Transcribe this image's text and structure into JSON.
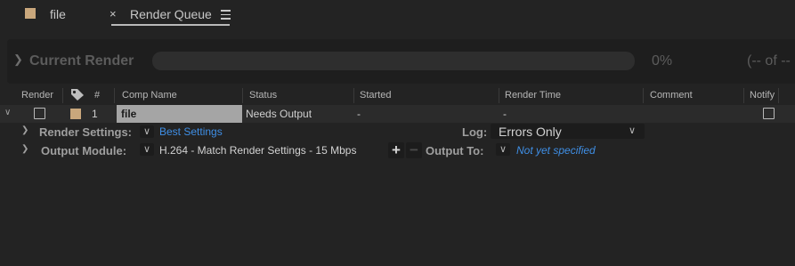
{
  "tabs": [
    {
      "label": "file"
    },
    {
      "label": "Render Queue",
      "close_glyph": "×"
    }
  ],
  "current_render": {
    "title": "Current Render",
    "percent": "0%",
    "remaining": "(-- of --"
  },
  "columns": [
    "Render",
    "#",
    "Comp Name",
    "Status",
    "Started",
    "Render Time",
    "Comment",
    "Notify"
  ],
  "row": {
    "index": "1",
    "comp_name": "file",
    "status": "Needs Output",
    "started": "-",
    "render_time": "-",
    "label_color": "#c9a77c"
  },
  "render_settings": {
    "label": "Render Settings:",
    "value": "Best Settings",
    "log_label": "Log:",
    "log_value": "Errors Only"
  },
  "output_module": {
    "label": "Output Module:",
    "value": "H.264 - Match Render Settings - 15 Mbps",
    "output_to_label": "Output To:",
    "output_to_value": "Not yet specified"
  },
  "icons": [
    "label-tag-icon",
    "hamburger-menu-icon",
    "chevron-right-icon",
    "chevron-down-icon",
    "plus-icon",
    "minus-icon"
  ]
}
